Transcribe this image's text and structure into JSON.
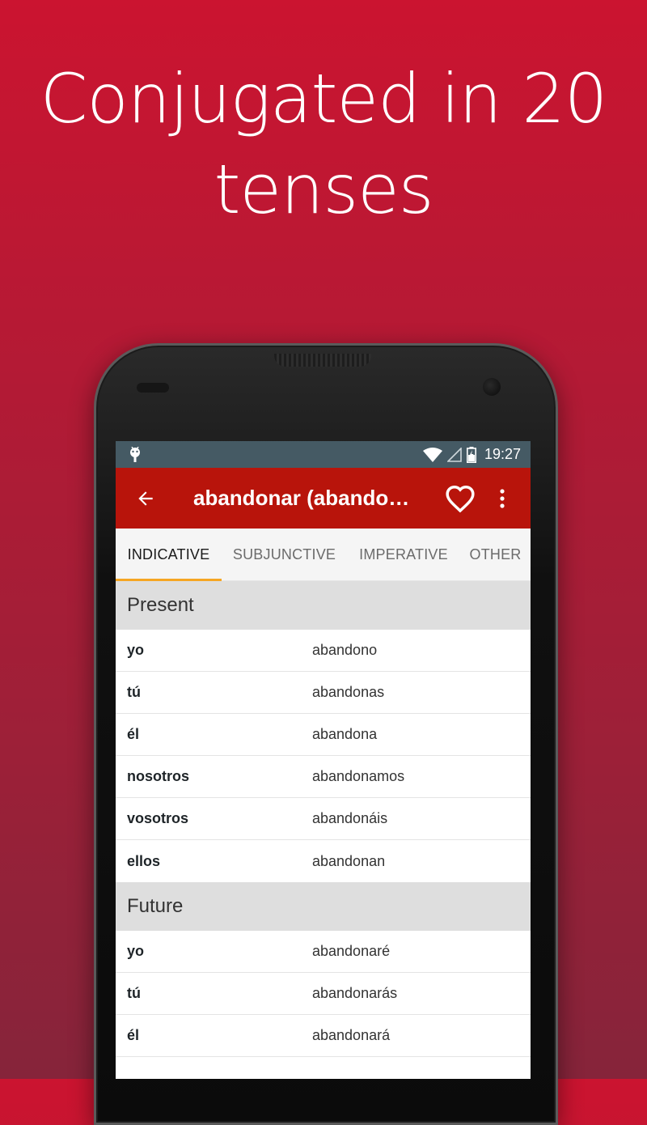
{
  "headline": {
    "line1": "Conjugated in 20",
    "line2": "tenses"
  },
  "statusbar": {
    "time": "19:27",
    "icons": [
      "android-debug-icon",
      "wifi-icon",
      "cell-signal-icon",
      "battery-charging-icon"
    ]
  },
  "appbar": {
    "title": "abandonar (abandon,…",
    "back_icon": "arrow-left-icon",
    "favorite_icon": "heart-outline-icon",
    "menu_icon": "more-vert-icon",
    "color": "#b8140b"
  },
  "tabs": [
    {
      "label": "INDICATIVE",
      "active": true
    },
    {
      "label": "SUBJUNCTIVE",
      "active": false
    },
    {
      "label": "IMPERATIVE",
      "active": false
    },
    {
      "label": "OTHER",
      "active": false
    }
  ],
  "sections": [
    {
      "title": "Present",
      "rows": [
        {
          "pronoun": "yo",
          "form": "abandono"
        },
        {
          "pronoun": "tú",
          "form": "abandonas"
        },
        {
          "pronoun": "él",
          "form": "abandona"
        },
        {
          "pronoun": "nosotros",
          "form": "abandonamos"
        },
        {
          "pronoun": "vosotros",
          "form": "abandonáis"
        },
        {
          "pronoun": "ellos",
          "form": "abandonan"
        }
      ]
    },
    {
      "title": "Future",
      "rows": [
        {
          "pronoun": "yo",
          "form": "abandonaré"
        },
        {
          "pronoun": "tú",
          "form": "abandonarás"
        },
        {
          "pronoun": "él",
          "form": "abandonará"
        }
      ]
    }
  ],
  "colors": {
    "accent_tab_indicator": "#f6a623",
    "statusbar": "#455a64",
    "background_top": "#cb1430",
    "background_bottom": "#86243a"
  }
}
